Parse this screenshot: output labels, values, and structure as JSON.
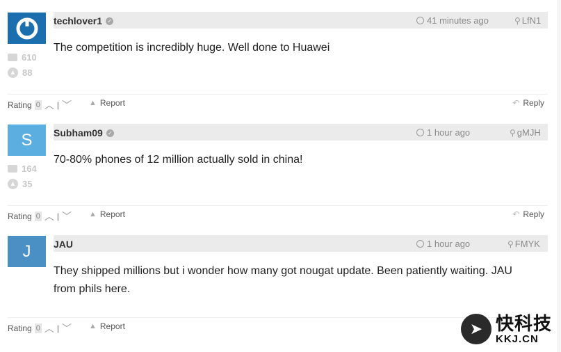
{
  "comments": [
    {
      "avatar_letter": "",
      "avatar_color": "#1b6fae",
      "username": "techlover1",
      "time": "41 minutes ago",
      "location": "LfN1",
      "posts_count": "610",
      "upvotes_count": "88",
      "text": "The competition is incredibly huge. Well done to Huawei",
      "rating_label": "Rating",
      "rating_value": "0",
      "report_label": "Report",
      "reply_label": "Reply"
    },
    {
      "avatar_letter": "S",
      "avatar_color": "#5aaee0",
      "username": "Subham09",
      "time": "1 hour ago",
      "location": "gMJH",
      "posts_count": "164",
      "upvotes_count": "35",
      "text": "70-80% phones of 12 million actually sold in china!",
      "rating_label": "Rating",
      "rating_value": "0",
      "report_label": "Report",
      "reply_label": "Reply"
    },
    {
      "avatar_letter": "J",
      "avatar_color": "#4a90c4",
      "username": "JAU",
      "time": "1 hour ago",
      "location": "FMYK",
      "text": "They shipped millions but i wonder how many got nougat update. Been patiently waiting. JAU from phils here.",
      "rating_label": "Rating",
      "rating_value": "0",
      "report_label": "Report"
    }
  ],
  "watermark": {
    "cn": "快科技",
    "en": "KKJ.CN"
  }
}
